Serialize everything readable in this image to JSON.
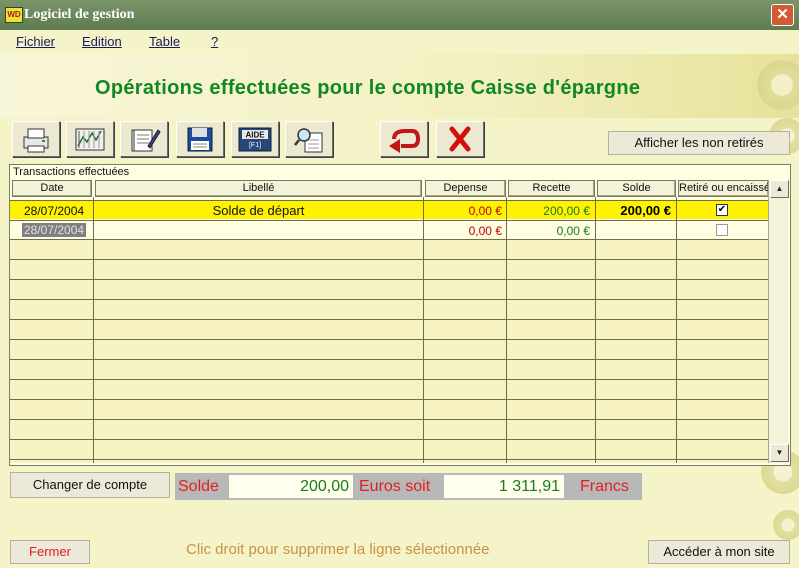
{
  "window": {
    "title": "Logiciel de gestion",
    "icon_text": "WD",
    "close_icon": "close-icon"
  },
  "menu": {
    "items": [
      "Fichier",
      "Edition",
      "Table",
      "?"
    ]
  },
  "page": {
    "title": "Opérations effectuées pour le compte Caisse d'épargne"
  },
  "toolbar": {
    "icons": [
      "printer-icon",
      "chart-icon",
      "book-icon",
      "save-icon",
      "aide-help-icon",
      "search-document-icon",
      "undo-icon",
      "delete-icon"
    ],
    "aide_label": "AIDE",
    "aide_sub": "[F1]",
    "afficher_label": "Afficher les non retirés"
  },
  "grid": {
    "caption": "Transactions effectuées",
    "columns": [
      "Date",
      "Libellé",
      "Depense",
      "Recette",
      "Solde",
      "Retiré ou encaissé"
    ],
    "rows": [
      {
        "date": "28/07/2004",
        "libelle": "Solde de départ",
        "depense": "0,00 €",
        "recette": "200,00 €",
        "solde": "200,00 €",
        "retire": true
      },
      {
        "date": "28/07/2004",
        "libelle": "",
        "depense": "0,00 €",
        "recette": "0,00 €",
        "solde": "",
        "retire": false
      }
    ],
    "colors": {
      "selected_row": "#FFF200",
      "depense": "#C00000",
      "recette": "#1A7A1A"
    }
  },
  "footer": {
    "changer_label": "Changer de compte",
    "solde_label": "Solde",
    "solde_value": "200,00",
    "euros_label": "Euros soit",
    "francs_value": "1 311,91",
    "francs_label": "Francs",
    "fermer_label": "Fermer",
    "hint": "Clic droit pour supprimer la ligne sélectionnée",
    "site_label": "Accéder à mon site"
  }
}
